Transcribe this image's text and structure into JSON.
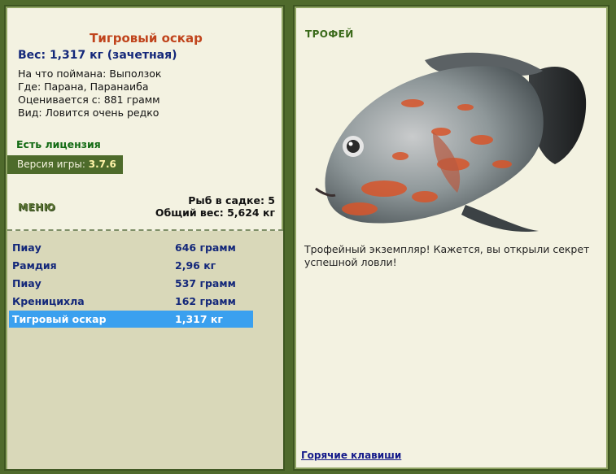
{
  "fish": {
    "name": "Тигровый оскар",
    "weight_line": "Вес: 1,317 кг (зачетная)",
    "bait": "На что поймана: Выползок",
    "location": "Где: Парана, Паранаиба",
    "score": "Оценивается с: 881 грамм",
    "rarity": "Вид: Ловится очень редко"
  },
  "license": "Есть лицензия",
  "version": {
    "label": "Версия игры: ",
    "value": "3.7.6"
  },
  "menu_label": "МЕНЮ",
  "keepnet": {
    "count": "Рыб в садке: 5",
    "total_weight": "Общий вес: 5,624 кг"
  },
  "catches": [
    {
      "name": "Пиау",
      "weight": "646 грамм"
    },
    {
      "name": "Рамдия",
      "weight": "2,96 кг"
    },
    {
      "name": "Пиау",
      "weight": "537 грамм"
    },
    {
      "name": "Креницихла",
      "weight": "162 грамм"
    },
    {
      "name": "Тигровый оскар",
      "weight": "1,317 кг"
    }
  ],
  "selected_catch_index": 4,
  "trophy": {
    "label": "ТРОФЕЙ",
    "image_icon": "tiger-oscar-fish-image",
    "text": "Трофейный экземпляр! Кажется, вы открыли секрет успешной ловли!"
  },
  "hotkeys_link": "Горячие клавиши",
  "colors": {
    "background": "#4f6a2c",
    "panel": "#f3f2e1",
    "catch_list_bg": "#d9d8b9",
    "selected_row": "#3aa0ef",
    "title": "#c0441c",
    "link_blue": "#14287a"
  }
}
